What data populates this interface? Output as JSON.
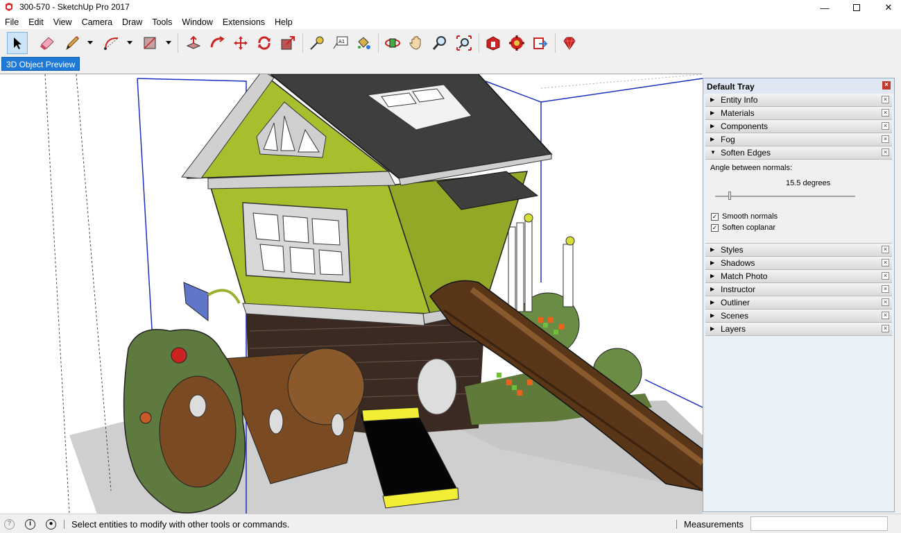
{
  "window": {
    "title": "300-570 - SketchUp Pro 2017"
  },
  "menu": [
    "File",
    "Edit",
    "View",
    "Camera",
    "Draw",
    "Tools",
    "Window",
    "Extensions",
    "Help"
  ],
  "scene_tab": "3D Object Preview",
  "tray": {
    "title": "Default Tray",
    "panels_top": [
      "Entity Info",
      "Materials",
      "Components",
      "Fog"
    ],
    "soften": {
      "label": "Soften Edges",
      "angle_label": "Angle between normals:",
      "angle_value": "15.5  degrees",
      "smooth_label": "Smooth normals",
      "coplanar_label": "Soften coplanar"
    },
    "panels_bottom": [
      "Styles",
      "Shadows",
      "Match Photo",
      "Instructor",
      "Outliner",
      "Scenes",
      "Layers"
    ]
  },
  "status": {
    "text": "Select entities to modify with other tools or commands.",
    "measurements_label": "Measurements",
    "measurements_value": ""
  }
}
